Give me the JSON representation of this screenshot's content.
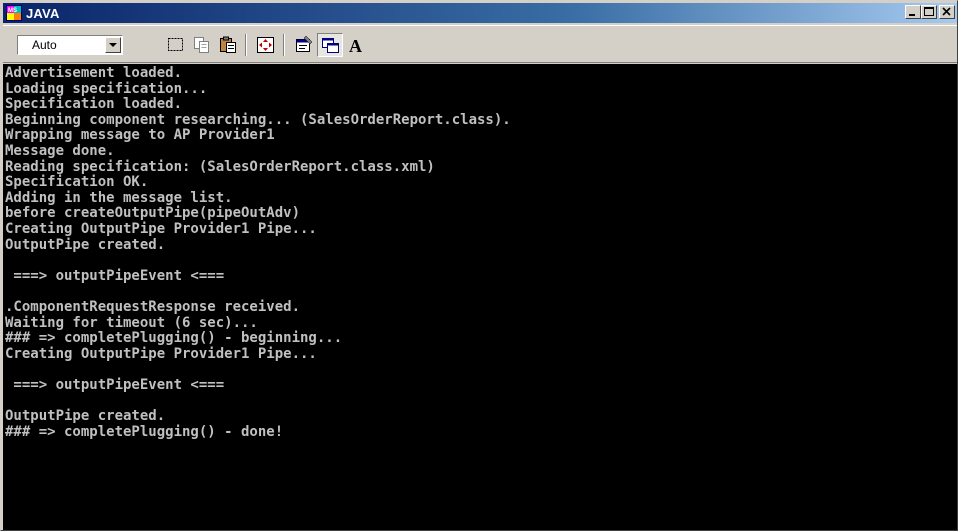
{
  "window": {
    "title": "JAVA",
    "app_icon": "ms-dos-icon",
    "buttons": [
      "minimize-icon",
      "maximize-icon",
      "close-icon"
    ]
  },
  "toolbar": {
    "font_size": {
      "value": "Auto"
    },
    "tools": [
      {
        "name": "mark-icon"
      },
      {
        "name": "copy-icon"
      },
      {
        "name": "paste-icon"
      },
      {
        "name": "fullscreen-icon"
      },
      {
        "name": "properties-icon"
      },
      {
        "name": "background-icon"
      },
      {
        "name": "font-icon"
      }
    ]
  },
  "console": {
    "lines": [
      "Advertisement loaded.",
      "Loading specification...",
      "Specification loaded.",
      "Beginning component researching... (SalesOrderReport.class).",
      "Wrapping message to AP Provider1",
      "Message done.",
      "Reading specification: (SalesOrderReport.class.xml)",
      "Specification OK.",
      "Adding in the message list.",
      "before createOutputPipe(pipeOutAdv)",
      "Creating OutputPipe Provider1 Pipe...",
      "OutputPipe created.",
      "",
      " ===> outputPipeEvent <===",
      "",
      ".ComponentRequestResponse received.",
      "Waiting for timeout (6 sec)...",
      "### => completePlugging() - beginning...",
      "Creating OutputPipe Provider1 Pipe...",
      "",
      " ===> outputPipeEvent <===",
      "",
      "OutputPipe created.",
      "### => completePlugging() - done!"
    ]
  },
  "colors": {
    "title_start": "#0a246a",
    "title_end": "#a6caf0",
    "console_bg": "#000000",
    "console_text": "#c0c0c0",
    "chrome": "#d4d0c8"
  }
}
